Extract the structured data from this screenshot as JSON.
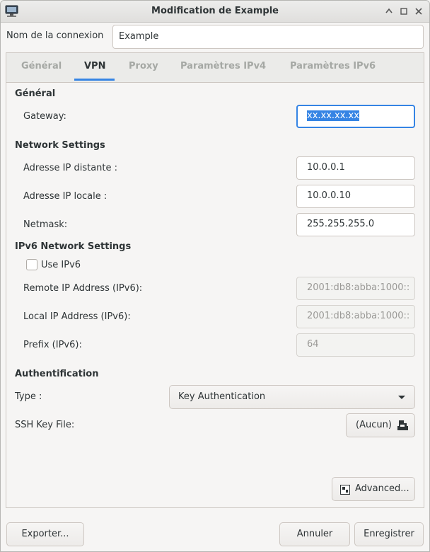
{
  "window": {
    "title": "Modification de Example"
  },
  "connection": {
    "name_label": "Nom de la connexion",
    "name_value": "Example"
  },
  "tabs": [
    {
      "label": "Général"
    },
    {
      "label": "VPN"
    },
    {
      "label": "Proxy"
    },
    {
      "label": "Paramètres IPv4"
    },
    {
      "label": "Paramètres IPv6"
    }
  ],
  "active_tab": "VPN",
  "general": {
    "heading": "Général",
    "gateway_label": "Gateway:",
    "gateway_value": "xx.xx.xx.xx"
  },
  "network": {
    "heading": "Network Settings",
    "remote_label": "Adresse IP distante :",
    "remote_value": "10.0.0.1",
    "local_label": "Adresse IP locale :",
    "local_value": "10.0.0.10",
    "netmask_label": "Netmask:",
    "netmask_value": "255.255.255.0"
  },
  "ipv6": {
    "heading": "IPv6 Network Settings",
    "use_label": "Use IPv6",
    "use_checked": false,
    "remote_label": "Remote IP Address (IPv6):",
    "remote_placeholder": "2001:db8:abba:1000::",
    "local_label": "Local IP Address (IPv6):",
    "local_placeholder": "2001:db8:abba:1000::",
    "prefix_label": "Prefix (IPv6):",
    "prefix_placeholder": "64"
  },
  "auth": {
    "heading": "Authentification",
    "type_label": "Type :",
    "type_value": "Key Authentication",
    "ssh_label": "SSH Key File:",
    "ssh_value": "(Aucun)"
  },
  "buttons": {
    "advanced": "Advanced...",
    "export": "Exporter...",
    "cancel": "Annuler",
    "save": "Enregistrer"
  },
  "colors": {
    "accent": "#3584e4"
  }
}
